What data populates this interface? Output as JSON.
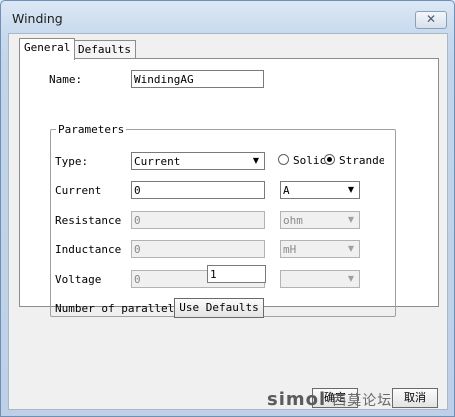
{
  "window": {
    "title": "Winding",
    "close_glyph": "✕"
  },
  "tabs": [
    {
      "label": "General",
      "active": true
    },
    {
      "label": "Defaults",
      "active": false
    }
  ],
  "name": {
    "label": "Name:",
    "value": "WindingAG"
  },
  "parameters": {
    "title": "Parameters",
    "type": {
      "label": "Type:",
      "value": "Current"
    },
    "radios": [
      {
        "label": "Solic",
        "checked": false
      },
      {
        "label": "Strandec",
        "checked": true
      }
    ],
    "current": {
      "label": "Current",
      "value": "0",
      "unit": "A"
    },
    "resistance": {
      "label": "Resistance",
      "value": "0",
      "unit": "ohm"
    },
    "inductance": {
      "label": "Inductance",
      "value": "0",
      "unit": "mH"
    },
    "voltage": {
      "label": "Voltage",
      "value": "0",
      "unit": ""
    },
    "parallel": {
      "label": "Number of parallel branc",
      "value": "1"
    }
  },
  "buttons": {
    "use_defaults": "Use Defaults",
    "ok": "确定",
    "cancel": "取消"
  },
  "watermark": {
    "brand": "simol",
    "suffix": "-西莫论坛"
  },
  "icons": {
    "dropdown_arrow": "▼"
  }
}
